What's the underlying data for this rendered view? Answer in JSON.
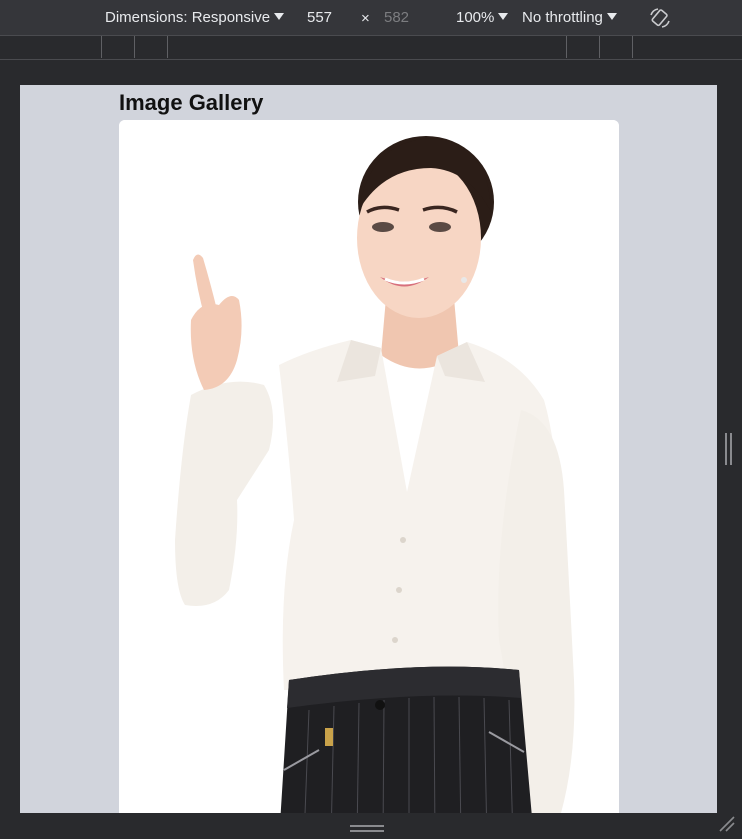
{
  "toolbar": {
    "dimensions_label": "Dimensions: Responsive",
    "width_value": "557",
    "times_sign": "×",
    "height_value": "582",
    "zoom_label": "100%",
    "throttling_label": "No throttling",
    "rotate_icon": "rotate-icon"
  },
  "page": {
    "title": "Image Gallery"
  },
  "image": {
    "alt": "Woman in white blouse pointing finger up"
  },
  "colors": {
    "toolbar_bg": "#35363a",
    "frame_bg": "#292a2d",
    "viewport_bg": "#d1d4dc",
    "card_bg": "#ffffff"
  }
}
